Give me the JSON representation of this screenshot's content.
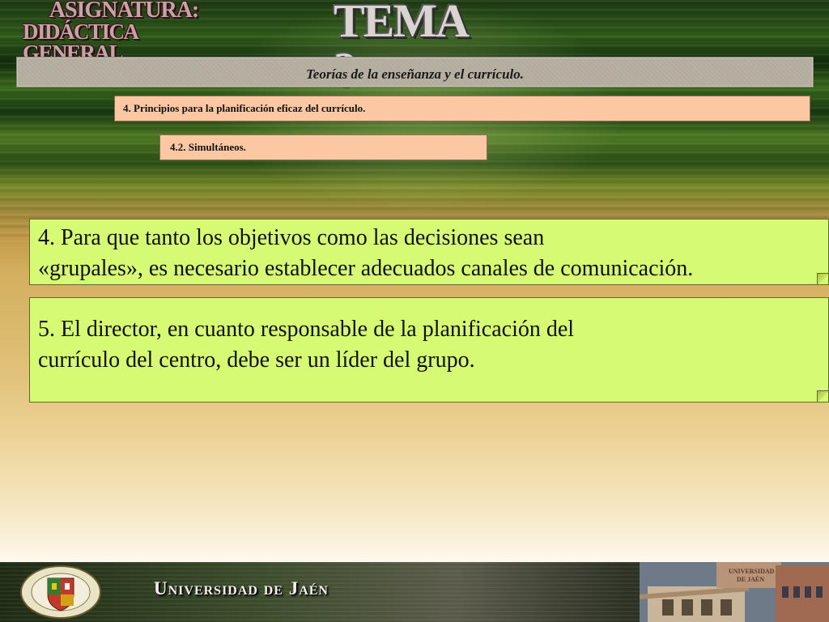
{
  "header": {
    "subject_line1": "ASIGNATURA:",
    "subject_line2": "DIDÁCTICA GENERAL",
    "topic": "TEMA 3"
  },
  "bars": {
    "main_title": "Teorías de la enseñanza y el currículo.",
    "section": "4. Principios para la planificación eficaz del currículo.",
    "subsection": "4.2. Simultáneos."
  },
  "notes": [
    {
      "line1": "4. Para que tanto los objetivos como las decisiones sean",
      "line2": "«grupales», es necesario establecer adecuados canales de comunicación."
    },
    {
      "line1": "5. El director, en cuanto responsable de la planificación del",
      "line2": "currículo del centro, debe ser un líder del grupo."
    }
  ],
  "footer": {
    "university": "Universidad de Jaén",
    "building_sign_line1": "UNIVERSIDAD",
    "building_sign_line2": "DE JAÉN"
  },
  "colors": {
    "note_bg": "#d6fa73",
    "section_bar_bg": "#fcc8a3",
    "main_bar_bg": "#b3ac9e"
  }
}
